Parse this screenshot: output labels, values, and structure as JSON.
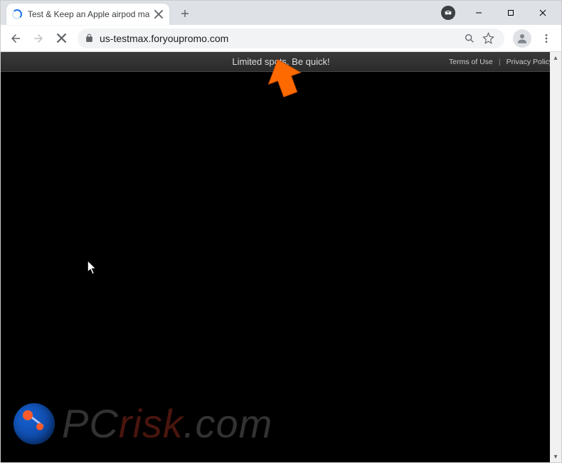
{
  "window": {
    "tab_title": "Test & Keep an Apple airpod ma",
    "url": "us-testmax.foryoupromo.com"
  },
  "page": {
    "banner_text": "Limited spots, Be quick!",
    "links": {
      "terms": "Terms of Use",
      "privacy": "Privacy Policy"
    }
  },
  "watermark": {
    "part1": "PC",
    "part2": "risk",
    "part3": ".com"
  },
  "icons": {
    "tab_spinner": "loading-spinner",
    "lock": "lock-icon",
    "search": "search-icon",
    "star": "star-icon",
    "avatar": "profile-icon",
    "menu": "kebab-menu-icon",
    "min": "minimize-icon",
    "max": "maximize-icon",
    "close": "close-icon"
  }
}
